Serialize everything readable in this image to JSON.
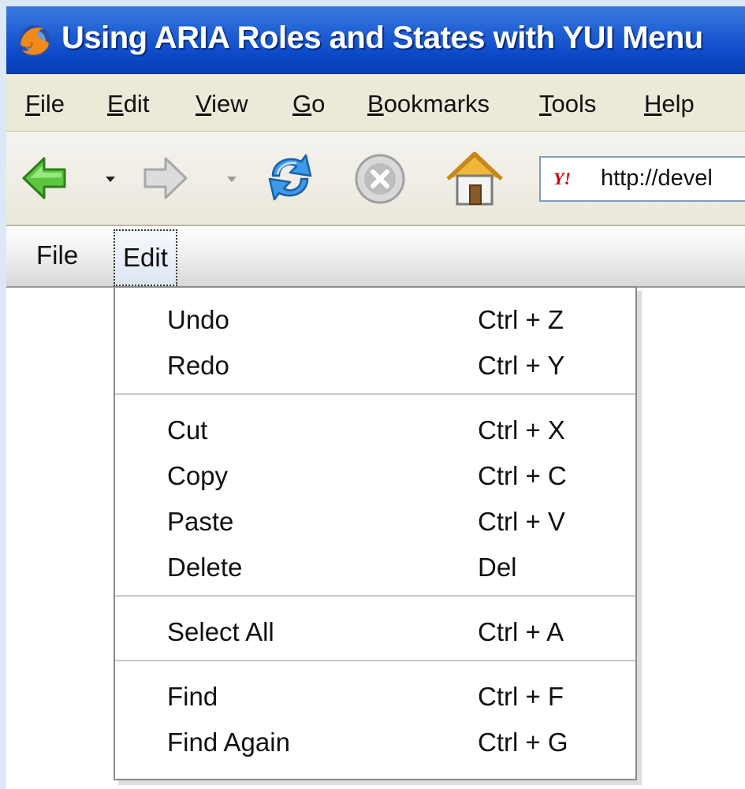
{
  "window": {
    "title": "Using ARIA Roles and States with YUI Menu",
    "app_icon": "firefox-logo"
  },
  "browser_menu": [
    {
      "label": "File",
      "accel": "F"
    },
    {
      "label": "Edit",
      "accel": "E"
    },
    {
      "label": "View",
      "accel": "V"
    },
    {
      "label": "Go",
      "accel": "G"
    },
    {
      "label": "Bookmarks",
      "accel": "B"
    },
    {
      "label": "Tools",
      "accel": "T"
    },
    {
      "label": "Help",
      "accel": "H"
    }
  ],
  "toolbar": {
    "buttons": [
      "back-icon",
      "forward-icon",
      "reload-icon",
      "stop-icon",
      "home-icon"
    ],
    "url": "http://devel",
    "site_icon": "Y!"
  },
  "yui_menubar": {
    "items": [
      "File",
      "Edit"
    ],
    "active": "Edit"
  },
  "edit_menu": {
    "groups": [
      [
        {
          "label": "Undo",
          "shortcut": "Ctrl + Z"
        },
        {
          "label": "Redo",
          "shortcut": "Ctrl + Y"
        }
      ],
      [
        {
          "label": "Cut",
          "shortcut": "Ctrl + X"
        },
        {
          "label": "Copy",
          "shortcut": "Ctrl + C"
        },
        {
          "label": "Paste",
          "shortcut": "Ctrl + V"
        },
        {
          "label": "Delete",
          "shortcut": "Del"
        }
      ],
      [
        {
          "label": "Select All",
          "shortcut": "Ctrl + A"
        }
      ],
      [
        {
          "label": "Find",
          "shortcut": "Ctrl + F"
        },
        {
          "label": "Find Again",
          "shortcut": "Ctrl + G"
        }
      ]
    ]
  },
  "colors": {
    "titlebar": "#1f5fd4",
    "chrome": "#ece9d8",
    "outer_border": "#dbe9f7"
  }
}
